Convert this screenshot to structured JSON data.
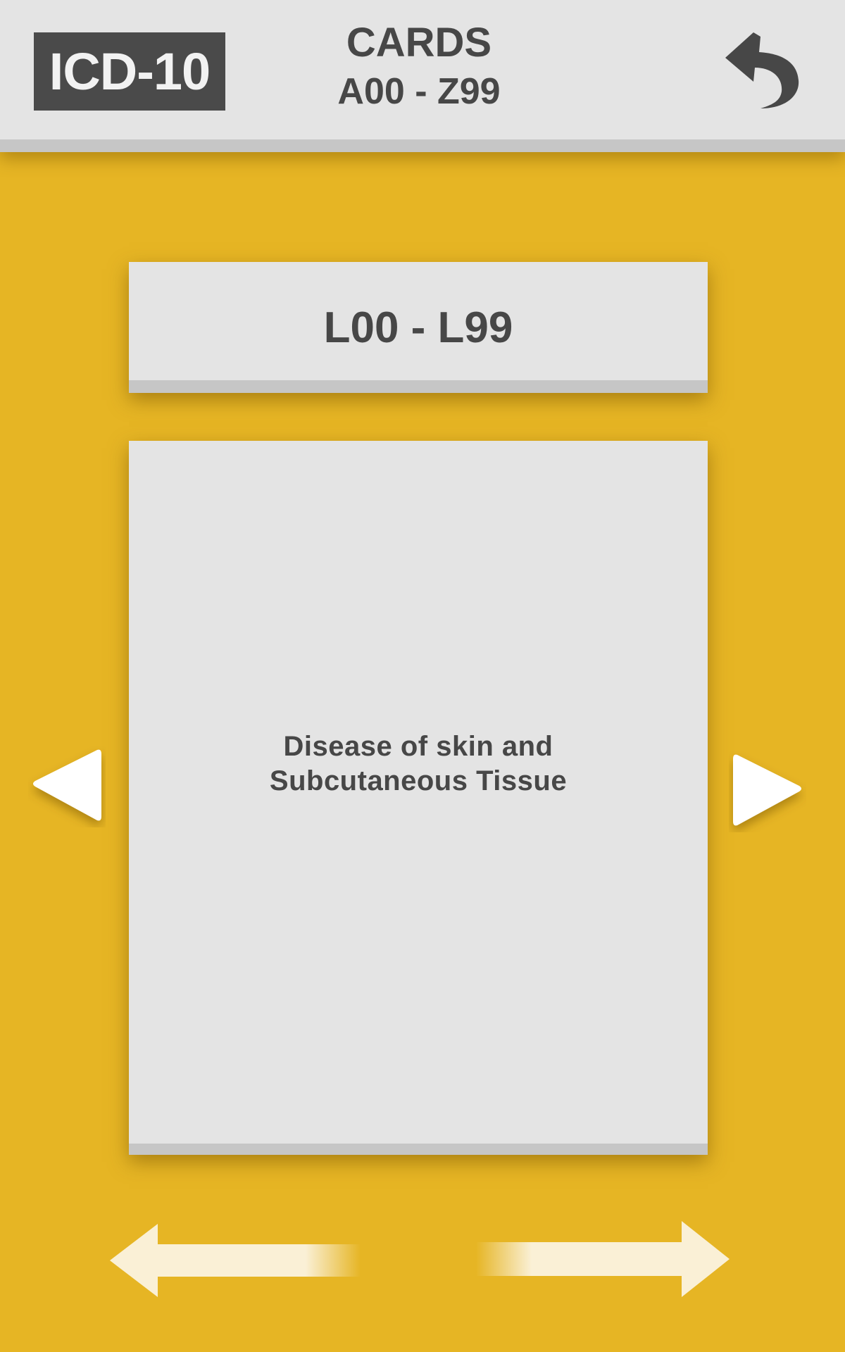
{
  "header": {
    "logo_text": "ICD-10",
    "title": "CARDS",
    "range": "A00 - Z99",
    "back_icon": "undo-arrow-icon"
  },
  "card": {
    "range": "L00 - L99",
    "description_line1": "Disease of skin and",
    "description_line2": "Subcutaneous Tissue"
  },
  "navigation": {
    "prev_icon": "triangle-left-icon",
    "next_icon": "triangle-right-icon",
    "swipe_left_icon": "swipe-left-arrow-icon",
    "swipe_right_icon": "swipe-right-arrow-icon"
  },
  "colors": {
    "background": "#E6B524",
    "card": "#E4E4E4",
    "card_edge": "#C6C6C6",
    "text": "#474747",
    "logo_bg": "#4A4A4A",
    "swipe_arrow": "#FAF0D6"
  }
}
